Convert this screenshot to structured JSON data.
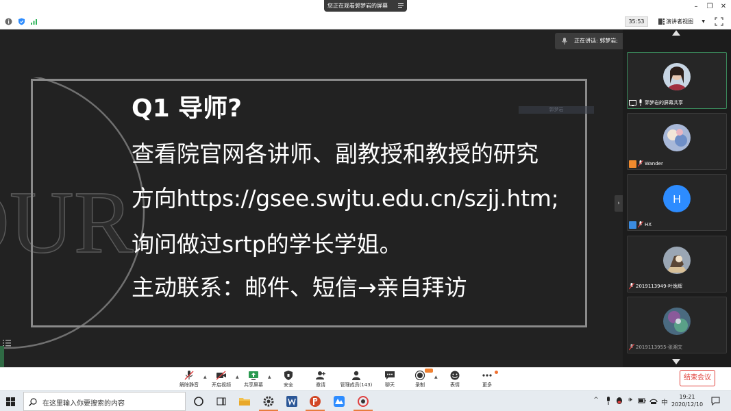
{
  "titlebar": {
    "share_notice": "您正在观看郭梦岩的屏幕",
    "minimize": "–",
    "restore": "❐",
    "close": "✕"
  },
  "infobar": {
    "timer": "35:53",
    "view_mode": "演讲者视图"
  },
  "speaking": {
    "label": "正在讲话: 郭梦岩;"
  },
  "slide": {
    "title": "Q1 导师?",
    "line1": "查看院官网各讲师、副教授和教授的研究",
    "line2": "方向https://gsee.swjtu.edu.cn/szjj.htm;",
    "line3": "询问做过srtp的学长学姐。",
    "line4": "主动联系：邮件、短信→亲自拜访",
    "deco_text": "OUR",
    "ghost_label": "郭梦岩"
  },
  "gallery": {
    "tiles": [
      {
        "name": "郭梦岩的屏幕共享",
        "badge_color": "#ffffff"
      },
      {
        "name": "Wander",
        "badge_color": "#f08a2e"
      },
      {
        "name": "HX",
        "badge_color": "#3b8be0",
        "initial": "H"
      },
      {
        "name": "2019113949-叶逸辉",
        "badge_color": ""
      },
      {
        "name": "2019113955-张湘文",
        "badge_color": ""
      }
    ]
  },
  "toolbar": {
    "mute": "解除静音",
    "video": "开启视频",
    "share": "共享屏幕",
    "security": "安全",
    "invite": "邀请",
    "participants": "管理成员(143)",
    "chat": "聊天",
    "record": "录制",
    "reactions": "表情",
    "more": "更多",
    "end": "结束会议"
  },
  "taskbar": {
    "search_placeholder": "在这里输入你要搜索的内容",
    "ime": "中",
    "time": "19:21",
    "date": "2020/12/10"
  },
  "colors": {
    "accent_green": "#3a8a5c",
    "end_red": "#e0403a",
    "zoom_blue": "#2d8cff",
    "taskbar_active": "#e87d3e"
  }
}
